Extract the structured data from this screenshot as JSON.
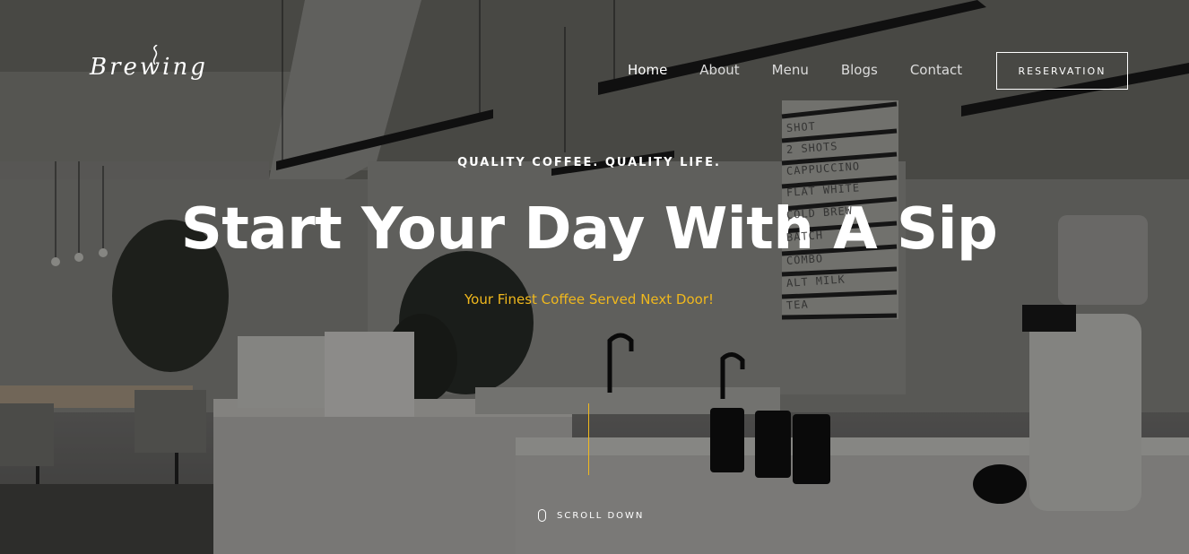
{
  "brand": {
    "logo_text": "Brewing"
  },
  "nav": {
    "items": [
      {
        "label": "Home",
        "active": true
      },
      {
        "label": "About",
        "active": false
      },
      {
        "label": "Menu",
        "active": false
      },
      {
        "label": "Blogs",
        "active": false
      },
      {
        "label": "Contact",
        "active": false
      }
    ],
    "reservation_label": "RESERVATION"
  },
  "hero": {
    "kicker": "QUALITY COFFEE. QUALITY LIFE.",
    "headline": "Start Your Day With A Sip",
    "subline": "Your Finest Coffee Served Next Door!",
    "scroll_label": "SCROLL DOWN"
  },
  "menu_board": {
    "items": [
      "SHOT",
      "2 SHOTS",
      "CAPPUCCINO",
      "FLAT WHITE",
      "COLD BREW",
      "BATCH",
      "COMBO",
      "ALT MILK",
      "TEA"
    ]
  },
  "colors": {
    "accent": "#f0b81d",
    "text": "#ffffff"
  }
}
